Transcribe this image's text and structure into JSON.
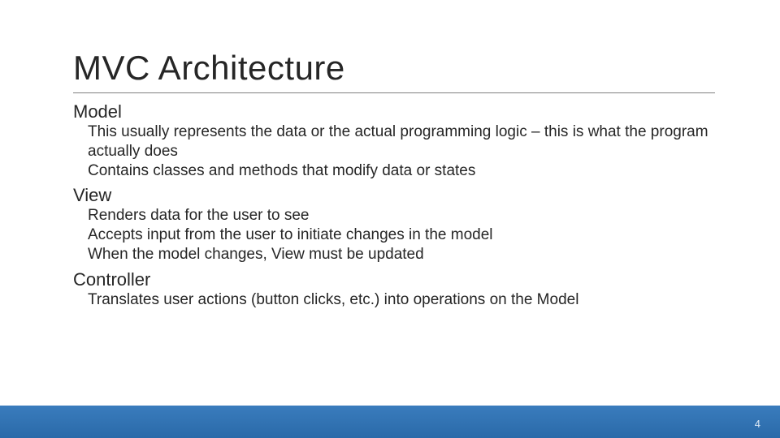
{
  "title": "MVC Architecture",
  "sections": [
    {
      "heading": "Model",
      "lines": [
        "This usually represents the data or the actual programming logic – this is what the program actually does",
        "Contains classes and methods that modify data or states"
      ]
    },
    {
      "heading": "View",
      "lines": [
        "Renders data for the user to see",
        "Accepts input from the user to initiate changes in the model",
        "When the model changes, View must be updated"
      ]
    },
    {
      "heading": "Controller",
      "lines": [
        "Translates user actions (button clicks, etc.) into operations on the Model"
      ]
    }
  ],
  "page_number": "4"
}
